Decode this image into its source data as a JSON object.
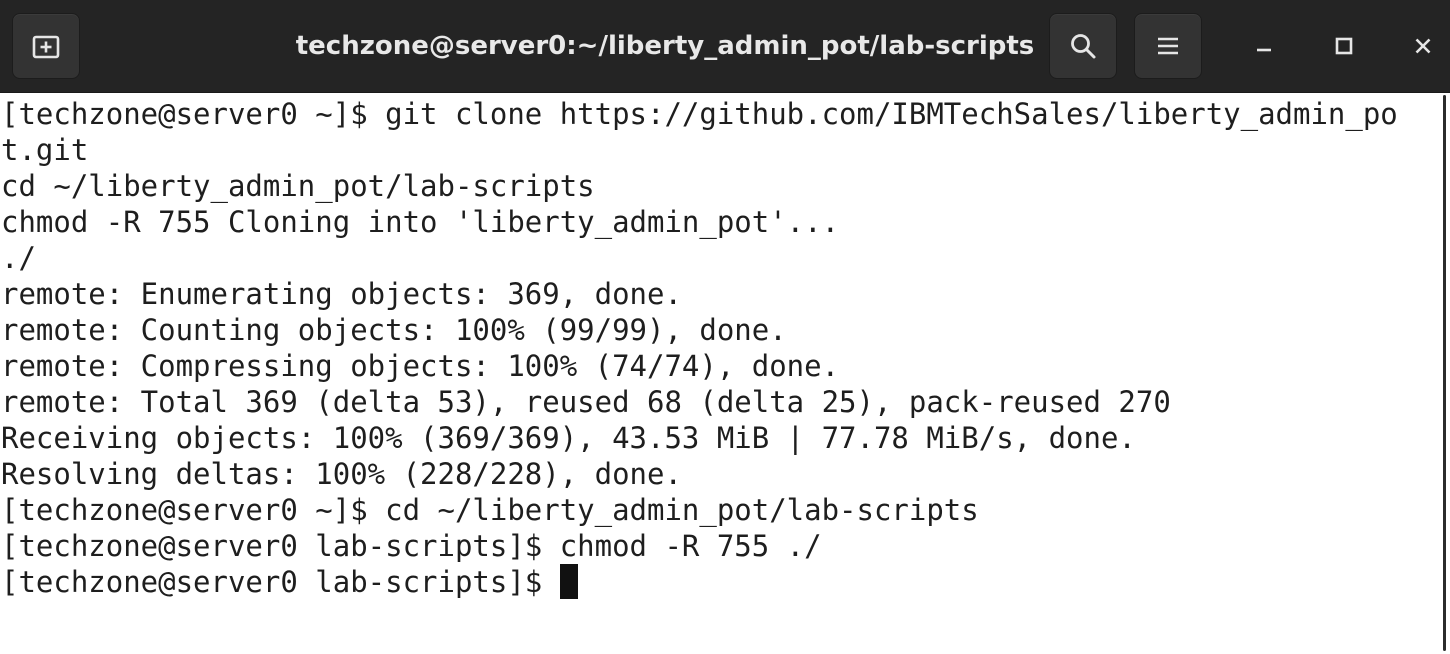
{
  "window": {
    "title": "techzone@server0:~/liberty_admin_pot/lab-scripts"
  },
  "titlebar": {
    "new_tab_icon": "new-tab-icon",
    "search_icon": "search-icon",
    "menu_icon": "hamburger-menu-icon",
    "minimize_icon": "minimize-icon",
    "maximize_icon": "maximize-icon",
    "close_icon": "close-icon"
  },
  "terminal": {
    "lines": [
      "[techzone@server0 ~]$ git clone https://github.com/IBMTechSales/liberty_admin_po",
      "t.git",
      "cd ~/liberty_admin_pot/lab-scripts",
      "chmod -R 755 Cloning into 'liberty_admin_pot'...",
      "./",
      "remote: Enumerating objects: 369, done.",
      "remote: Counting objects: 100% (99/99), done.",
      "remote: Compressing objects: 100% (74/74), done.",
      "remote: Total 369 (delta 53), reused 68 (delta 25), pack-reused 270",
      "Receiving objects: 100% (369/369), 43.53 MiB | 77.78 MiB/s, done.",
      "Resolving deltas: 100% (228/228), done.",
      "[techzone@server0 ~]$ cd ~/liberty_admin_pot/lab-scripts",
      "[techzone@server0 lab-scripts]$ chmod -R 755 ./",
      "[techzone@server0 lab-scripts]$ "
    ]
  },
  "colors": {
    "titlebar_bg": "#242424",
    "button_bg": "#333333",
    "terminal_bg": "#ffffff",
    "terminal_fg": "#1e1e1e"
  }
}
